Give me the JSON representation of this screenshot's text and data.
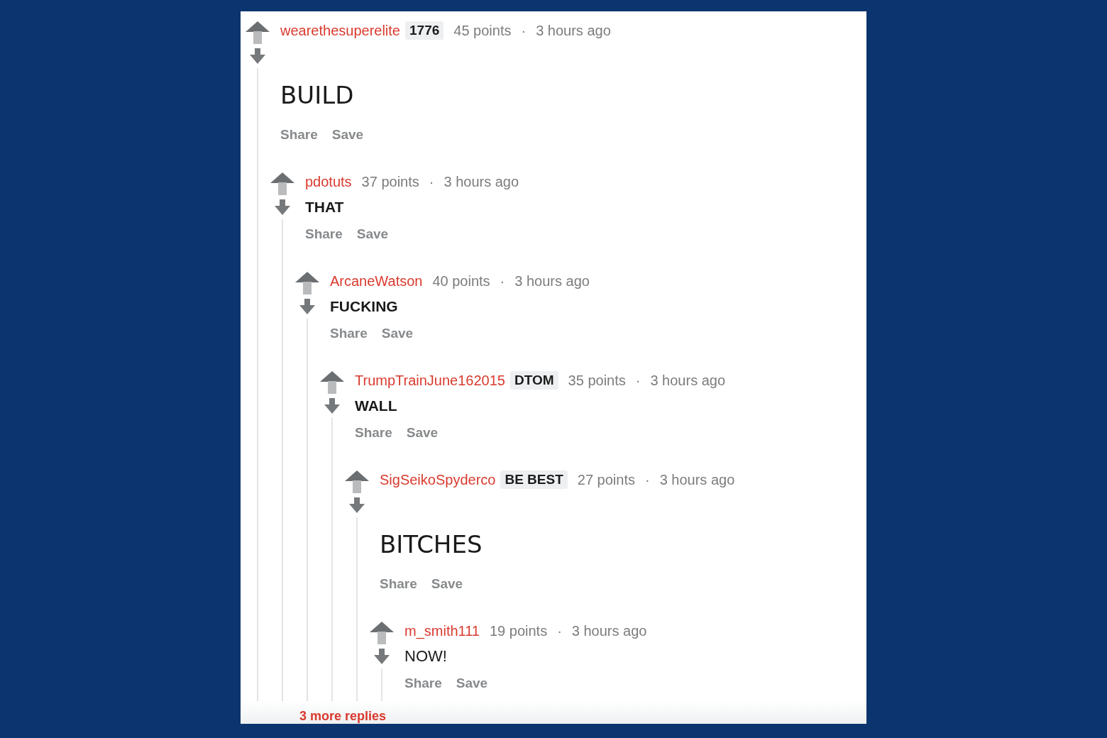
{
  "comments": [
    {
      "author": "wearethesuperelite",
      "flair": "1776",
      "points": "45 points",
      "separator": "·",
      "time": "3 hours ago",
      "body": "BUILD",
      "kind": "heading",
      "actions": [
        "Share",
        "Save"
      ],
      "children": [
        {
          "author": "pdotuts",
          "points": "37 points",
          "separator": "·",
          "time": "3 hours ago",
          "body": "THAT",
          "kind": "strong",
          "actions": [
            "Share",
            "Save"
          ],
          "children": [
            {
              "author": "ArcaneWatson",
              "points": "40 points",
              "separator": "·",
              "time": "3 hours ago",
              "body": "FUCKING",
              "kind": "strong",
              "actions": [
                "Share",
                "Save"
              ],
              "children": [
                {
                  "author": "TrumpTrainJune162015",
                  "flair": "DTOM",
                  "points": "35 points",
                  "separator": "·",
                  "time": "3 hours ago",
                  "body": "WALL",
                  "kind": "strong",
                  "actions": [
                    "Share",
                    "Save"
                  ],
                  "children": [
                    {
                      "author": "SigSeikoSpyderco",
                      "flair": "BE BEST",
                      "points": "27 points",
                      "separator": "·",
                      "time": "3 hours ago",
                      "body": "BITCHES",
                      "kind": "heading",
                      "actions": [
                        "Share",
                        "Save"
                      ],
                      "children": [
                        {
                          "author": "m_smith111",
                          "points": "19 points",
                          "separator": "·",
                          "time": "3 hours ago",
                          "body": "NOW!",
                          "kind": "text",
                          "actions": [
                            "Share",
                            "Save"
                          ]
                        }
                      ]
                    }
                  ]
                }
              ]
            }
          ]
        }
      ]
    }
  ],
  "more_replies": "3 more replies"
}
